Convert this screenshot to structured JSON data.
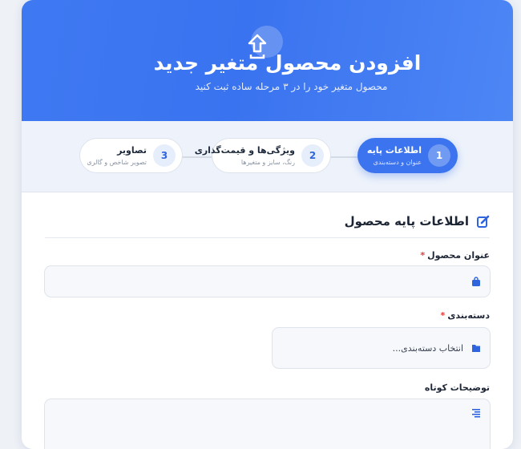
{
  "header": {
    "title": "افزودن محصول متغیر جدید",
    "subtitle": "محصول متغیر خود را در ۳ مرحله ساده ثبت کنید",
    "icon": "upload-arrow-icon"
  },
  "steps": [
    {
      "num": "1",
      "title": "اطلاعات پایه",
      "desc": "عنوان و دسته‌بندی",
      "active": true
    },
    {
      "num": "2",
      "title": "ویژگی‌ها و قیمت‌گذاری",
      "desc": "رنگ، سایز و متغیرها",
      "active": false
    },
    {
      "num": "3",
      "title": "تصاویر",
      "desc": "تصویر شاخص و گالری",
      "active": false
    }
  ],
  "section": {
    "title": "اطلاعات پایه محصول",
    "icon": "edit-icon"
  },
  "form": {
    "title_label": "عنوان محصول",
    "title_required": "*",
    "title_value": "",
    "title_icon": "shopping-bag-icon",
    "category_label": "دسته‌بندی",
    "category_required": "*",
    "category_placeholder": "انتخاب دسته‌بندی...",
    "category_icon": "folder-icon",
    "desc_label": "توضیحات کوتاه",
    "desc_icon": "align-right-icon"
  },
  "colors": {
    "primary": "#3b74ee",
    "required": "#e53b3b"
  }
}
